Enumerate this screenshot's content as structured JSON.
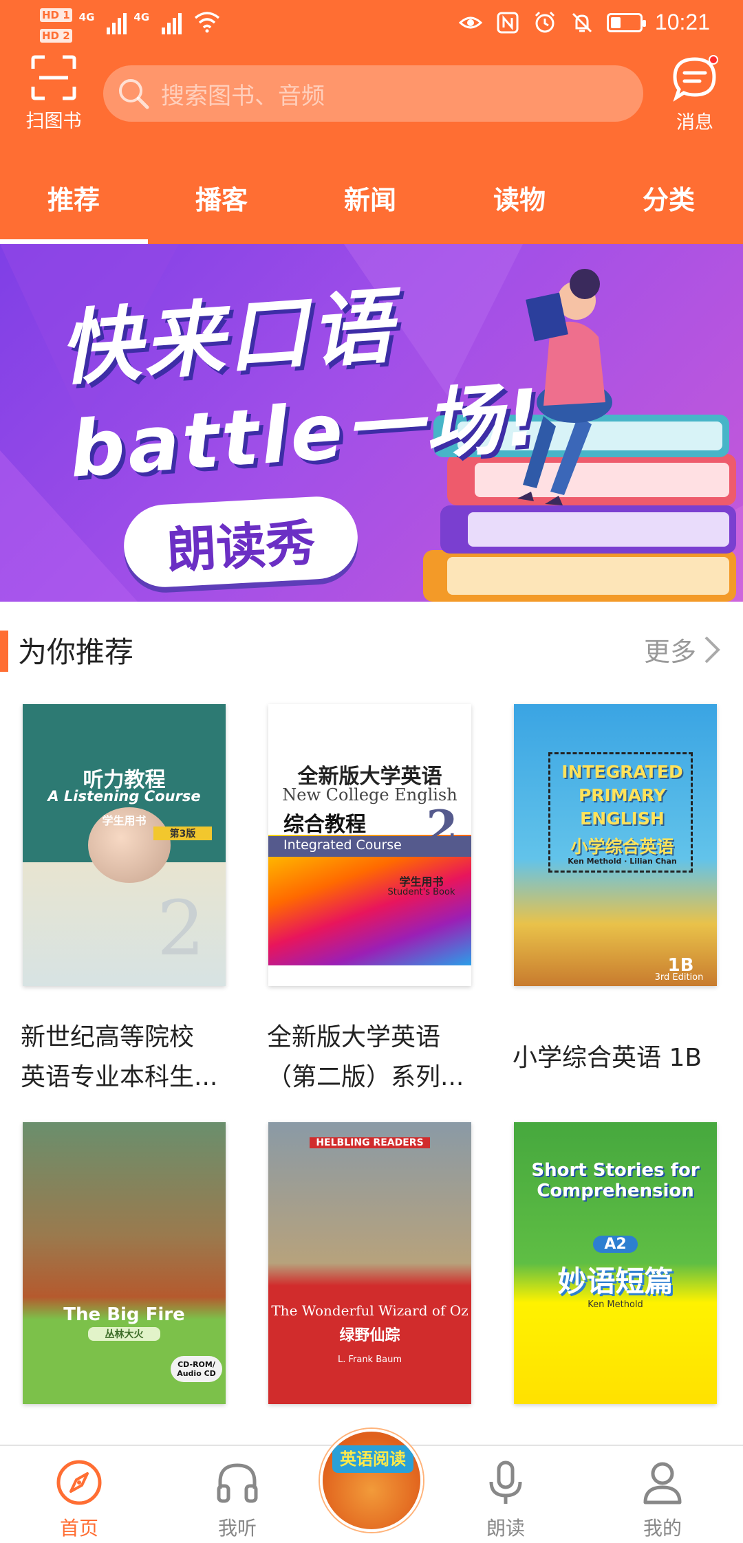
{
  "status_bar": {
    "sim1": "HD 1",
    "sim2": "HD 2",
    "net1": "4G",
    "net2": "4G",
    "time": "10:21"
  },
  "header": {
    "scan_label": "扫图书",
    "search_placeholder": "搜索图书、音频",
    "messages_label": "消息",
    "tabs": [
      {
        "label": "推荐",
        "active": true
      },
      {
        "label": "播客",
        "active": false
      },
      {
        "label": "新闻",
        "active": false
      },
      {
        "label": "读物",
        "active": false
      },
      {
        "label": "分类",
        "active": false
      }
    ],
    "accent_color": "#ff6e33"
  },
  "banner": {
    "line1": "快来口语",
    "line2": "battle一场!",
    "button": "朗读秀"
  },
  "recommend": {
    "title": "为你推荐",
    "more": "更多",
    "books": [
      {
        "name_line1": "新世纪高等院校",
        "name_line2": "英语专业本科生...",
        "cover_title": "听力教程",
        "cover_subtitle": "A Listening Course",
        "cover_badge": "学生用书",
        "cover_edition": "第3版",
        "cover_number": "2"
      },
      {
        "name_line1": "全新版大学英语",
        "name_line2": "（第二版）系列...",
        "cover_title": "全新版大学英语",
        "cover_subtitle": "New College English",
        "cover_course_cn": "综合教程",
        "cover_course_en": "Integrated Course",
        "cover_badge": "学生用书",
        "cover_badge_en": "Student's Book",
        "cover_number": "2"
      },
      {
        "name_line1": "小学综合英语 1B",
        "cover_title": "INTEGRATED PRIMARY ENGLISH",
        "cover_subtitle": "小学综合英语",
        "cover_author": "Ken Methold · Lilian Chan",
        "cover_level": "1B",
        "cover_edition": "3rd Edition"
      },
      {
        "cover_title": "The Big Fire",
        "cover_subtitle": "丛林大火",
        "cover_badge": "CD-ROM/ Audio CD"
      },
      {
        "cover_series": "HELBLING READERS",
        "cover_title": "The Wonderful Wizard of Oz",
        "cover_subtitle": "绿野仙踪",
        "cover_author": "L. Frank Baum"
      },
      {
        "cover_title": "Short Stories for Comprehension",
        "cover_level": "A2",
        "cover_subtitle": "妙语短篇",
        "cover_author": "Ken Methold"
      }
    ]
  },
  "bottom_nav": {
    "items": [
      {
        "label": "首页",
        "icon": "compass-icon",
        "active": true
      },
      {
        "label": "我听",
        "icon": "headphones-icon",
        "active": false
      },
      {
        "label": "朗读",
        "icon": "microphone-icon",
        "active": false
      },
      {
        "label": "我的",
        "icon": "person-icon",
        "active": false
      }
    ],
    "center_badge": "英语阅读"
  }
}
